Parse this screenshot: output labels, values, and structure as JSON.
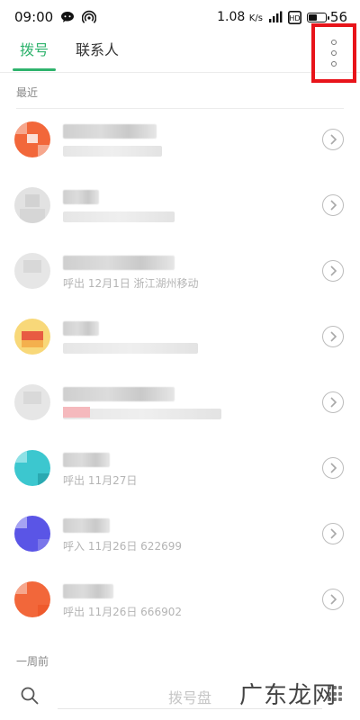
{
  "status_bar": {
    "time": "09:00",
    "network_speed": "1.08",
    "network_unit": "K/s",
    "battery": "56",
    "battery_level": 0.56
  },
  "tabs": [
    {
      "label": "拨号",
      "active": true
    },
    {
      "label": "联系人",
      "active": false
    }
  ],
  "sections": {
    "recent": "最近",
    "week_ago": "一周前"
  },
  "calls": [
    {
      "avatar_color": "#f2673a",
      "sub": ""
    },
    {
      "avatar_color": "#d9d9d9",
      "sub": ""
    },
    {
      "avatar_color": "#dcdcdc",
      "sub": "呼出 12月1日 浙江湖州移动"
    },
    {
      "avatar_color": "#f7c944",
      "sub": ""
    },
    {
      "avatar_color": "#dcdcdc",
      "sub": ""
    },
    {
      "avatar_color": "#3cc7cf",
      "sub": "呼出 11月27日"
    },
    {
      "avatar_color": "#5a55e6",
      "sub": "呼入 11月26日 622699"
    },
    {
      "avatar_color": "#f2673a",
      "sub": "呼出 11月26日 666902"
    }
  ],
  "bottom": {
    "dial_placeholder": "拨号盘"
  },
  "watermark": "广东龙网",
  "colors": {
    "accent": "#2fb36d",
    "highlight": "#e8141a"
  }
}
